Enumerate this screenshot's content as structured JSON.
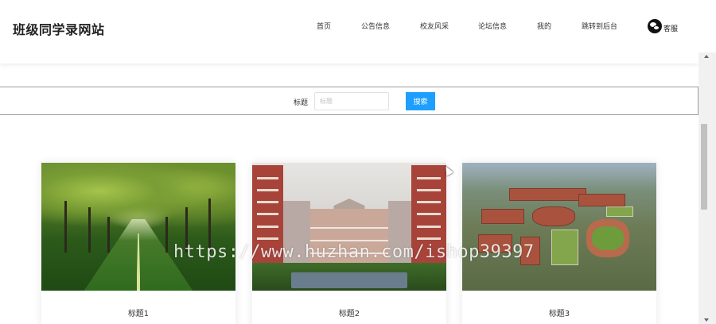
{
  "header": {
    "logo": "班级同学录网站",
    "nav": [
      {
        "label": "首页"
      },
      {
        "label": "公告信息"
      },
      {
        "label": "校友风采"
      },
      {
        "label": "论坛信息"
      },
      {
        "label": "我的"
      },
      {
        "label": "跳转到后台"
      }
    ],
    "service": {
      "label": "客服",
      "icon": "wechat-icon"
    }
  },
  "search": {
    "label": "标题",
    "placeholder": "标题",
    "value": "",
    "button": "搜索",
    "button_color": "#1e9fff"
  },
  "cards": [
    {
      "title": "标题1",
      "image": "tree-lined-road-photo"
    },
    {
      "title": "标题2",
      "image": "campus-building-photo"
    },
    {
      "title": "标题3",
      "image": "aerial-campus-render"
    }
  ],
  "watermark": "https://www.huzhan.com/ishop39397"
}
